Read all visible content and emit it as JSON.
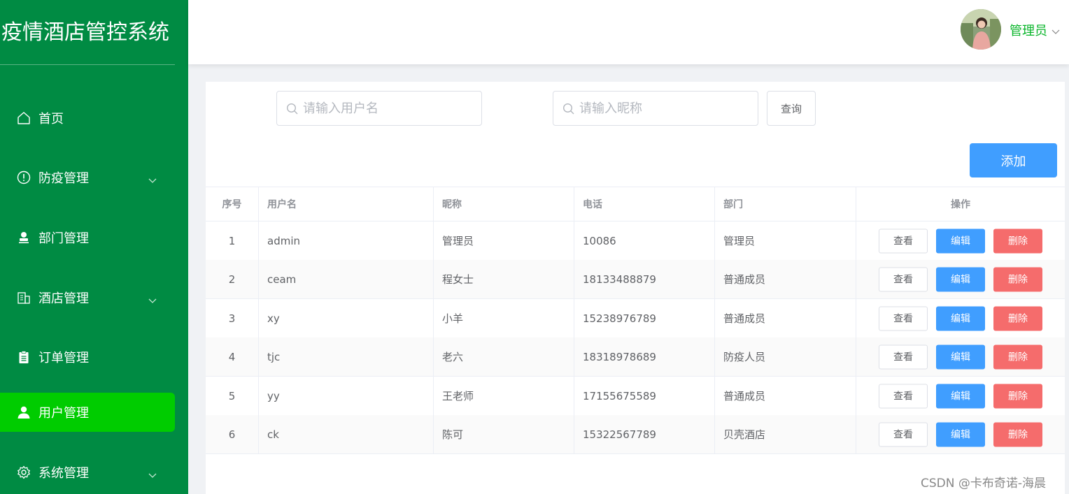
{
  "app": {
    "title": "疫情酒店管控系统"
  },
  "sidebar": {
    "items": [
      {
        "label": "首页",
        "icon": "home-icon",
        "has_arrow": false,
        "active": false
      },
      {
        "label": "防疫管理",
        "icon": "warning-circle-icon",
        "has_arrow": true,
        "active": false
      },
      {
        "label": "部门管理",
        "icon": "stamp-icon",
        "has_arrow": false,
        "active": false
      },
      {
        "label": "酒店管理",
        "icon": "building-icon",
        "has_arrow": true,
        "active": false
      },
      {
        "label": "订单管理",
        "icon": "clipboard-icon",
        "has_arrow": false,
        "active": false
      },
      {
        "label": "用户管理",
        "icon": "user-icon",
        "has_arrow": false,
        "active": true
      },
      {
        "label": "系统管理",
        "icon": "gear-icon",
        "has_arrow": true,
        "active": false
      }
    ]
  },
  "header": {
    "user_name": "管理员"
  },
  "search": {
    "username_placeholder": "请输入用户名",
    "nickname_placeholder": "请输入昵称",
    "query_label": "查询"
  },
  "toolbar": {
    "add_label": "添加"
  },
  "table": {
    "headers": [
      "序号",
      "用户名",
      "昵称",
      "电话",
      "部门",
      "操作"
    ],
    "rows": [
      {
        "id": "1",
        "username": "admin",
        "nickname": "管理员",
        "phone": "10086",
        "dept": "管理员"
      },
      {
        "id": "2",
        "username": "ceam",
        "nickname": "程女士",
        "phone": "18133488879",
        "dept": "普通成员"
      },
      {
        "id": "3",
        "username": "xy",
        "nickname": "小羊",
        "phone": "15238976789",
        "dept": "普通成员"
      },
      {
        "id": "4",
        "username": "tjc",
        "nickname": "老六",
        "phone": "18318978689",
        "dept": "防疫人员"
      },
      {
        "id": "5",
        "username": "yy",
        "nickname": "王老师",
        "phone": "17155675589",
        "dept": "普通成员"
      },
      {
        "id": "6",
        "username": "ck",
        "nickname": "陈可",
        "phone": "15322567789",
        "dept": "贝壳酒店"
      }
    ],
    "actions": {
      "view": "查看",
      "edit": "编辑",
      "delete": "删除"
    }
  },
  "watermark": "CSDN @卡布奇诺-海晨",
  "colors": {
    "sidebar_bg": "#008b43",
    "active_item": "#00cc00",
    "primary": "#409eff",
    "danger": "#f56c6c",
    "user_name": "#09b52a"
  }
}
